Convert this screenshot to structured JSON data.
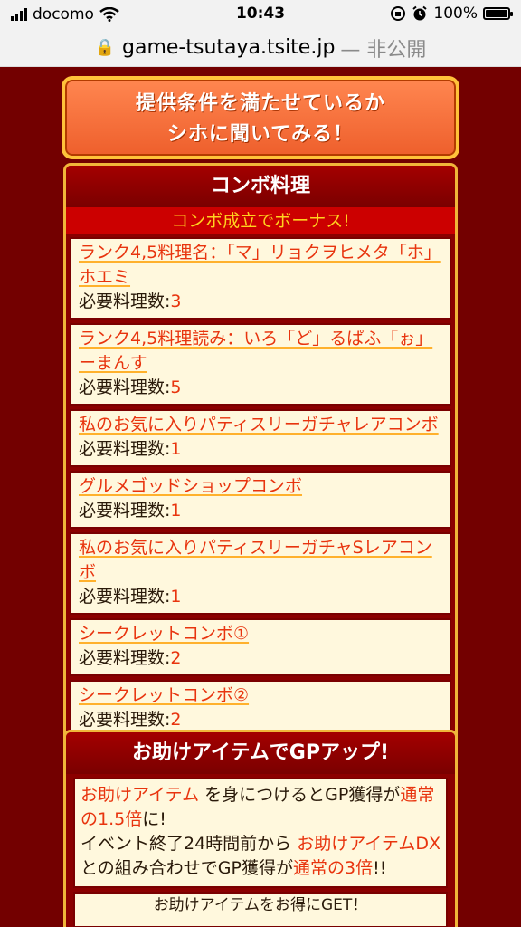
{
  "status_bar": {
    "carrier": "docomo",
    "time": "10:43",
    "battery": "100%"
  },
  "url_bar": {
    "domain": "game-tsutaya.tsite.jp",
    "status": "— 非公開"
  },
  "ask_button": {
    "line1": "提供条件を満たせているか",
    "line2": "シホに聞いてみる！"
  },
  "combo": {
    "title": "コンボ料理",
    "subtitle": "コンボ成立でボーナス!",
    "req_label": "必要料理数:",
    "items": [
      {
        "name": "ランク4,5料理名：「マ」リョクヲヒメタ「ホ」ホエミ",
        "count": "3"
      },
      {
        "name": "ランク4,5料理読み：いろ「ど」るぱふ「ぉ」ーまんす",
        "count": "5"
      },
      {
        "name": "私のお気に入りパティスリーガチャレアコンボ",
        "count": "1"
      },
      {
        "name": "グルメゴッドショップコンボ",
        "count": "1"
      },
      {
        "name": "私のお気に入りパティスリーガチャSレアコンボ",
        "count": "1"
      },
      {
        "name": "シークレットコンボ①",
        "count": "2"
      },
      {
        "name": "シークレットコンボ②",
        "count": "2"
      }
    ]
  },
  "help": {
    "title": "お助けアイテムでGPアップ!",
    "p1": "お助けアイテム",
    "p2": " を身につけるとGP獲得が",
    "p3": "通常の1.5倍",
    "p4": "に!",
    "p5": "イベント終了24時間前から ",
    "p6": "お助けアイテムDX",
    "p7": "との組み合わせでGP獲得が",
    "p8": "通常の3倍",
    "p9": "!!",
    "footer": "お助けアイテムをお得にGET！"
  }
}
